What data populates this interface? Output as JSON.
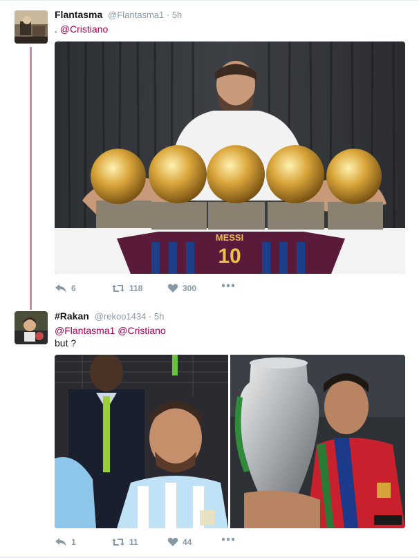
{
  "tweets": [
    {
      "fullname": "Flantasma",
      "handle": "@Flantasma1",
      "time": "5h",
      "text_prefix": ". ",
      "mentions": [
        "@Cristiano"
      ],
      "text_suffix": "",
      "image_alt": "Messi posing with five Ballon d'Or trophies and a Barcelona number 10 jersey",
      "replies": "6",
      "retweets": "118",
      "likes": "300"
    },
    {
      "fullname": "#Rakan",
      "handle": "@rekoo1434",
      "time": "5h",
      "mentions": [
        "@Flantasma1",
        "@Cristiano"
      ],
      "text_line2": "but ?",
      "image_left_alt": "Messi crying in Argentina jersey",
      "image_right_alt": "Ronaldo kissing the Euro 2016 trophy",
      "replies": "1",
      "retweets": "11",
      "likes": "44"
    }
  ],
  "icons": {
    "reply": "reply-icon",
    "retweet": "retweet-icon",
    "like": "heart-icon",
    "more": "more-icon"
  },
  "colors": {
    "mention": "#a0004f",
    "thread_line": "#d08aa9",
    "meta": "#8899a6"
  }
}
